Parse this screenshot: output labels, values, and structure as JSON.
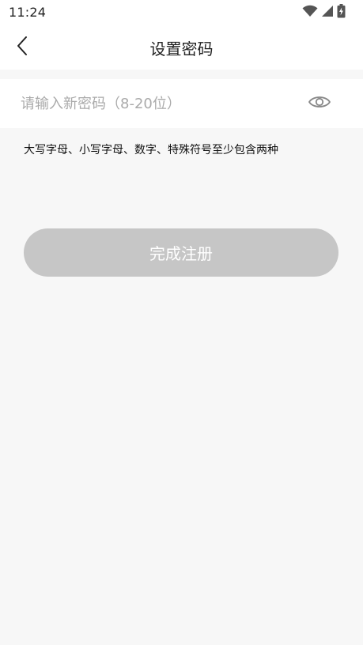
{
  "status_bar": {
    "time": "11:24",
    "icons": [
      "wifi-icon",
      "cellular-signal-icon",
      "battery-charging-icon"
    ]
  },
  "nav": {
    "title": "设置密码",
    "back_icon": "chevron-left-icon"
  },
  "password_field": {
    "placeholder": "请输入新密码（8-20位）",
    "value": "",
    "visibility_icon": "eye-icon"
  },
  "hint": "大写字母、小写字母、数字、特殊符号至少包含两种",
  "submit_button": {
    "label": "完成注册",
    "background": "#c6c6c6",
    "text_color": "#ffffff"
  },
  "colors": {
    "page_background": "#f7f7f7",
    "surface": "#ffffff",
    "placeholder": "#aaaaaa"
  }
}
